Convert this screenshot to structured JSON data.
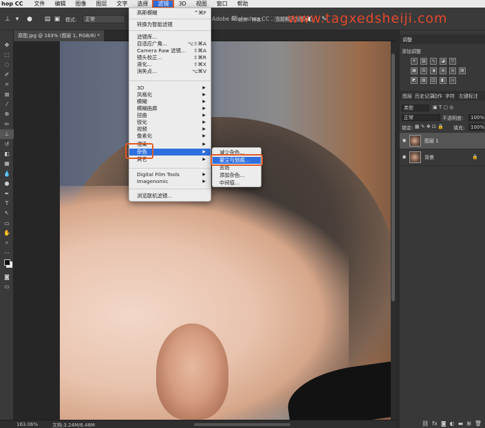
{
  "menubar": {
    "app": "hop CC",
    "items": [
      "文件",
      "编辑",
      "图像",
      "图层",
      "文字",
      "选择",
      "滤镜",
      "3D",
      "视图",
      "窗口",
      "帮助"
    ],
    "active": "滤镜"
  },
  "options": {
    "mode_label": "模式:",
    "mode_value": "正常",
    "align_label": "对齐",
    "sample_label": "样本:",
    "sample_value": "当前和下方图层",
    "window_title": "Adobe Photoshop CC 2018"
  },
  "watermark": "www.tagxedsheiji.com",
  "document": {
    "tab_label": "原图.jpg @ 163% (图层 1, RGB/8) *"
  },
  "status": {
    "zoom": "163.06%",
    "doc_size": "文档:3.24M/6.48M"
  },
  "filter_menu": {
    "items": [
      {
        "label": "高斯模糊",
        "shortcut": "^⌘F"
      },
      {
        "label": "转换为智能滤镜",
        "shortcut": ""
      },
      {
        "label": "滤镜库...",
        "shortcut": ""
      },
      {
        "label": "自适应广角...",
        "shortcut": "⌥⇧⌘A"
      },
      {
        "label": "Camera Raw 滤镜...",
        "shortcut": "⇧⌘A"
      },
      {
        "label": "镜头校正...",
        "shortcut": "⇧⌘R"
      },
      {
        "label": "液化...",
        "shortcut": "⇧⌘X"
      },
      {
        "label": "消失点...",
        "shortcut": "⌥⌘V"
      },
      {
        "label": "3D",
        "shortcut": ""
      },
      {
        "label": "风格化",
        "shortcut": ""
      },
      {
        "label": "模糊",
        "shortcut": ""
      },
      {
        "label": "模糊画廊",
        "shortcut": ""
      },
      {
        "label": "扭曲",
        "shortcut": ""
      },
      {
        "label": "锐化",
        "shortcut": ""
      },
      {
        "label": "视频",
        "shortcut": ""
      },
      {
        "label": "像素化",
        "shortcut": ""
      },
      {
        "label": "渲染",
        "shortcut": ""
      },
      {
        "label": "杂色",
        "shortcut": ""
      },
      {
        "label": "其它",
        "shortcut": ""
      },
      {
        "label": "Digital Film Tools",
        "shortcut": ""
      },
      {
        "label": "Imagenomic",
        "shortcut": ""
      },
      {
        "label": "浏览联机滤镜...",
        "shortcut": ""
      }
    ],
    "highlighted": "杂色"
  },
  "noise_menu": {
    "items": [
      "减少杂色...",
      "蒙尘与划痕...",
      "去斑",
      "添加杂色...",
      "中间值..."
    ],
    "highlighted": "蒙尘与划痕..."
  },
  "panels": {
    "adjustments_tab": "调整",
    "adjustments_sub": "添加调整",
    "layers_tabs": [
      "图层",
      "历史记录",
      "动作",
      "字符",
      "左键标注"
    ],
    "kind_label": "类型",
    "blend_mode": "正常",
    "opacity_label": "不透明度:",
    "opacity_value": "100%",
    "lock_label": "锁定:",
    "fill_label": "填充:",
    "fill_value": "100%",
    "layers": [
      {
        "name": "图层 1",
        "selected": true,
        "locked": false
      },
      {
        "name": "背景",
        "selected": false,
        "locked": true
      }
    ]
  },
  "colors": {
    "accent": "#2f6fdf",
    "annotation": "#e05a25"
  }
}
